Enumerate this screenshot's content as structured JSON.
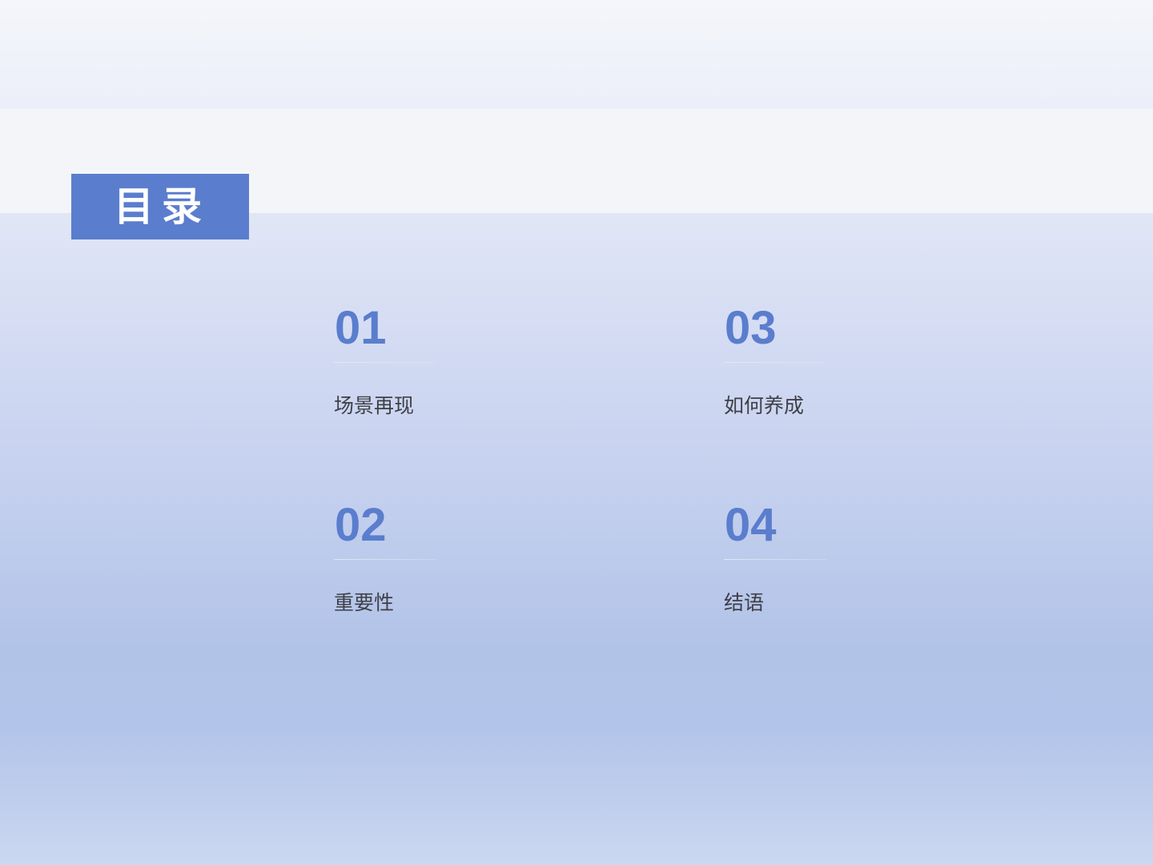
{
  "title": "目录",
  "accent_color": "#5a7dcd",
  "items": [
    {
      "number": "01",
      "label": "场景再现"
    },
    {
      "number": "02",
      "label": "重要性"
    },
    {
      "number": "03",
      "label": "如何养成"
    },
    {
      "number": "04",
      "label": "结语"
    }
  ]
}
